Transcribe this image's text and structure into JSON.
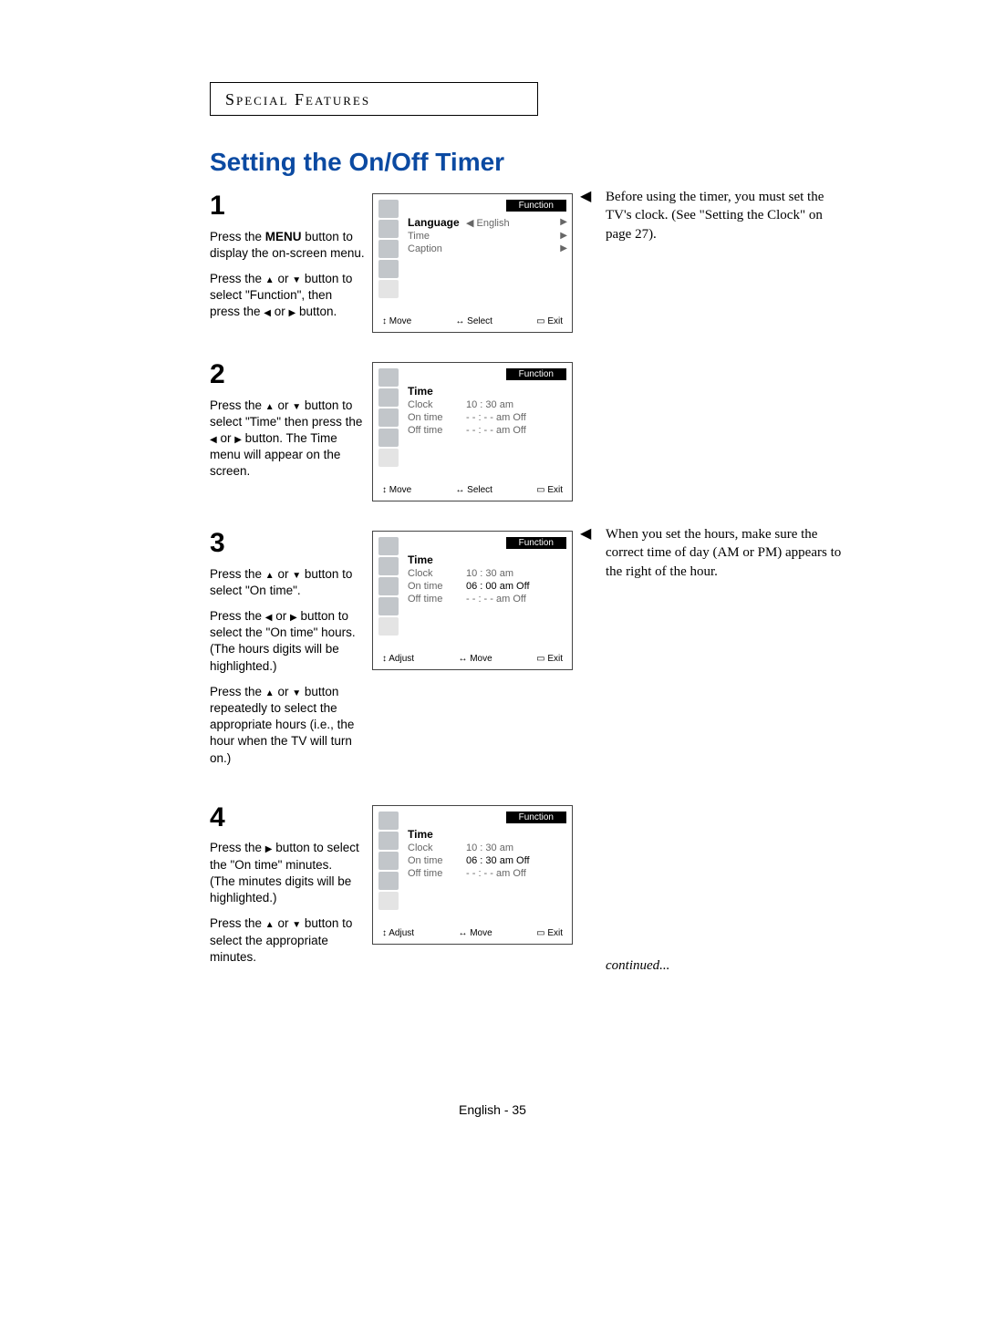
{
  "section_header": "Special Features",
  "title": "Setting the On/Off Timer",
  "glyphs": {
    "up": "▲",
    "down": "▼",
    "left": "◀",
    "right": "▶",
    "updown": "▲▼",
    "leftright": "◀▶",
    "note_arrow": "◀"
  },
  "steps": {
    "s1": {
      "num": "1",
      "p1a": "Press the ",
      "p1b": "MENU",
      "p1c": " button to display the on-screen menu.",
      "p2a": "Press the ",
      "p2b": " or ",
      "p2c": " button to select \"Function\", then press the ",
      "p2d": " or ",
      "p2e": " button.",
      "osd": {
        "title": "Function",
        "l1_label": "Language",
        "l1_val": "◀   English",
        "l2_label": "Time",
        "l3_label": "Caption",
        "f1": "Move",
        "f2": "Select",
        "f3": "Exit",
        "kind": "move"
      },
      "note": "Before using the timer, you must set the TV's clock. (See \"Setting the Clock\" on page 27)."
    },
    "s2": {
      "num": "2",
      "p1a": "Press the ",
      "p1b": " or ",
      "p1c": " button to select \"Time\" then press the ",
      "p1d": " or ",
      "p1e": " button. The Time menu will appear on the screen.",
      "osd": {
        "title": "Function",
        "l0_label": "Time",
        "l1_label": "Clock",
        "l1_val": "10 : 30 am",
        "l2_label": "On time",
        "l2_val": "- -  :  - - am   Off",
        "l3_label": "Off time",
        "l3_val": "- -  :  - - am   Off",
        "f1": "Move",
        "f2": "Select",
        "f3": "Exit",
        "kind": "move"
      }
    },
    "s3": {
      "num": "3",
      "p1a": "Press the ",
      "p1b": " or ",
      "p1c": " button to select \"On time\".",
      "p2a": "Press the ",
      "p2b": " or ",
      "p2c": " button to select the \"On time\" hours.",
      "p2d": "(The hours digits will be highlighted.)",
      "p3a": "Press the ",
      "p3b": " or ",
      "p3c": " button repeatedly to select the appropriate hours (i.e., the hour when the TV will turn on.)",
      "osd": {
        "title": "Function",
        "l0_label": "Time",
        "l1_label": "Clock",
        "l1_val": "10 : 30 am",
        "l2_label": "On time",
        "l2_val": "06 : 00 am   Off",
        "l3_label": "Off time",
        "l3_val": "- -  :  - - am   Off",
        "f1": "Adjust",
        "f2": "Move",
        "f3": "Exit",
        "kind": "adjust"
      },
      "note": "When you set the hours, make sure the correct time of day (AM or PM) appears to the right of the hour."
    },
    "s4": {
      "num": "4",
      "p1a": "Press the ",
      "p1b": " button to select the \"On time\" minutes.",
      "p1c": "(The minutes digits will be highlighted.)",
      "p2a": "Press the ",
      "p2b": " or ",
      "p2c": " button to select the appropriate minutes.",
      "osd": {
        "title": "Function",
        "l0_label": "Time",
        "l1_label": "Clock",
        "l1_val": "10 : 30 am",
        "l2_label": "On time",
        "l2_val": "06 : 30 am   Off",
        "l3_label": "Off time",
        "l3_val": "- -  :  - - am   Off",
        "f1": "Adjust",
        "f2": "Move",
        "f3": "Exit",
        "kind": "adjust"
      },
      "continued": "continued..."
    }
  },
  "footer": "English - 35"
}
